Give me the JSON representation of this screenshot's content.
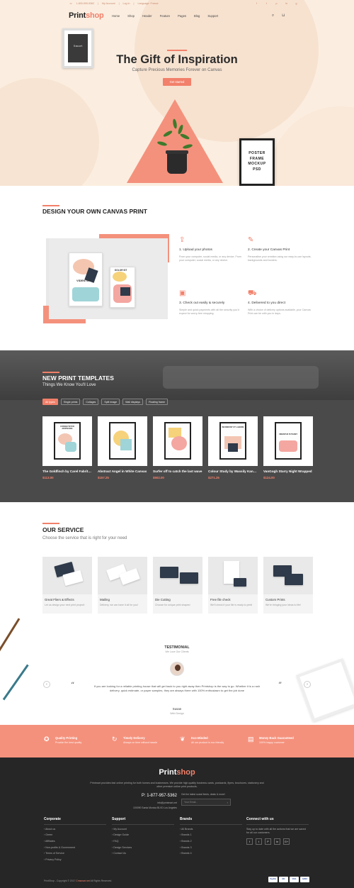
{
  "topbar": {
    "phone": "1-800-999-5362",
    "account": "My Account",
    "login": "Log In",
    "language": "Language: France"
  },
  "logo": {
    "part1": "Print",
    "part2": "shop"
  },
  "nav": {
    "items": [
      "Home",
      "Shop",
      "Header",
      "Feature",
      "Pages",
      "Blog",
      "Support"
    ]
  },
  "hero": {
    "frame_text": "Smart",
    "title": "The Gift of Inspiration",
    "subtitle": "Capture Precious Memories Forever on Canvas",
    "cta": "Get started",
    "poster_text": "POSTER FRAME MOCKUP PSD"
  },
  "design": {
    "title": "DESIGN YOUR OWN CANVAS PRINT",
    "canvas_a": "VIDENTUR",
    "canvas_b": "DOLOR SIT",
    "steps": [
      {
        "title": "1. Upload your photos",
        "text": "From your computer, social media, or any device. From your computer, social media, or any device."
      },
      {
        "title": "2. Create your Canvas Print",
        "text": "Personalise your creation using our easy-to-use layouts, backgrounds and borders."
      },
      {
        "title": "3. Check out easily & securely",
        "text": "Simple and quick payments with all the security you'd expect for worry-free shopping."
      },
      {
        "title": "4. Delivered to you direct",
        "text": "With a choice of delivery options available, your Canvas Print can be with you in days."
      }
    ]
  },
  "templates": {
    "title": "NEW PRINT TEMPLATES",
    "subtitle": "Things We Know You'll Love",
    "filters": [
      "All types",
      "Single prints",
      "Collages",
      "Split image",
      "Wall displays",
      "Floating frame"
    ],
    "products": [
      {
        "name": "The Goldfinch by Carel Fabritius",
        "price": "$113.00",
        "art": "CONSECTETUR ADIPISCING"
      },
      {
        "name": "Abstract Angel in White Canvas",
        "price": "$157.25",
        "art": ""
      },
      {
        "name": "Surfer off to catch the last wave",
        "price": "$502.00",
        "art": ""
      },
      {
        "name": "Colour Study by Wassily Kandinsky",
        "price": "$271.25",
        "art": "INCIDIDUNT UT LABORE"
      },
      {
        "name": "VanGogh Starry Night Wrapped",
        "price": "$124.00",
        "art": "VIDENTUR PUTARET"
      }
    ]
  },
  "service": {
    "title": "OUR SERVICE",
    "subtitle": "Choose the service that is right for your need",
    "items": [
      {
        "title": "Great Fliers & Effects",
        "text": "Let us design your next print project!"
      },
      {
        "title": "Mailing",
        "text": "Delivery, we can have it all for you!"
      },
      {
        "title": "Die Cutting",
        "text": "Choose for unique print shapes!"
      },
      {
        "title": "Free file check",
        "text": "We'll check if your file is ready to print!"
      },
      {
        "title": "Custom Prints",
        "text": "We're bringing your ideas to life!"
      }
    ]
  },
  "testimonial": {
    "title": "TESTIMONIAL",
    "subtitle": "We Love Our Clients",
    "quote": "If you are looking for a reliable printing house that will get back to you right away then Printshop is the way to go. Whether it is a rush delivery, quick estimate, or paper samples, they are always there with 100% enthusiasm to get the job done",
    "name": "Susan",
    "role": "Web Design",
    "open_quote": "“",
    "close_quote": "”",
    "prev": "‹",
    "next": "›"
  },
  "features": [
    {
      "title": "Quality Printing",
      "text": "Provide the best quality"
    },
    {
      "title": "Timely Delivery",
      "text": "Always on time without hassle"
    },
    {
      "title": "Eco-Minded",
      "text": "All our product is eco friendly"
    },
    {
      "title": "Money Back Guaranteed",
      "text": "100% happy customer"
    }
  ],
  "footer": {
    "description": "Printmart provides fast online printing for both homes and businesses. We provide high quality business cards, postcards, flyers, brochures, stationery and other premium online print products.",
    "phone": "P: 1-877-957-5362",
    "email": "info@printmart.net",
    "address": "100090 Santa Monica BLVD Los Angeles",
    "newsletter_text": "Get the latest social feeds, deals & more!",
    "newsletter_placeholder": "Your Email...",
    "newsletter_go": "›",
    "columns": [
      {
        "head": "Corporate",
        "links": [
          "About us",
          "Green",
          "Affiliates",
          "Non-profits & Government",
          "Terms of Service",
          "Privacy Policy"
        ]
      },
      {
        "head": "Support",
        "links": [
          "My Account",
          "Design Guide",
          "FAQ",
          "Design Services",
          "Contact Us"
        ]
      },
      {
        "head": "Brands",
        "links": [
          "All Brands",
          "Brands 1",
          "Brands 2",
          "Brands 3",
          "Brands 4"
        ]
      }
    ],
    "connect_head": "Connect with us",
    "connect_text": "Stay up to date with all the actions that we are saved for all our customers.",
    "socials": [
      "f",
      "t",
      "P",
      "in",
      "G+"
    ],
    "copyright_pre": "PrintShop - Copyright © 2017",
    "copyright_brand": "Cmsmart.net",
    "copyright_post": "All Rights Reserved.",
    "payments": [
      "PayPal",
      "MC",
      "VISA",
      "AMEX"
    ]
  },
  "colors": {
    "accent": "#f2806a",
    "peach": "#fbeee0",
    "dark": "#262626"
  }
}
